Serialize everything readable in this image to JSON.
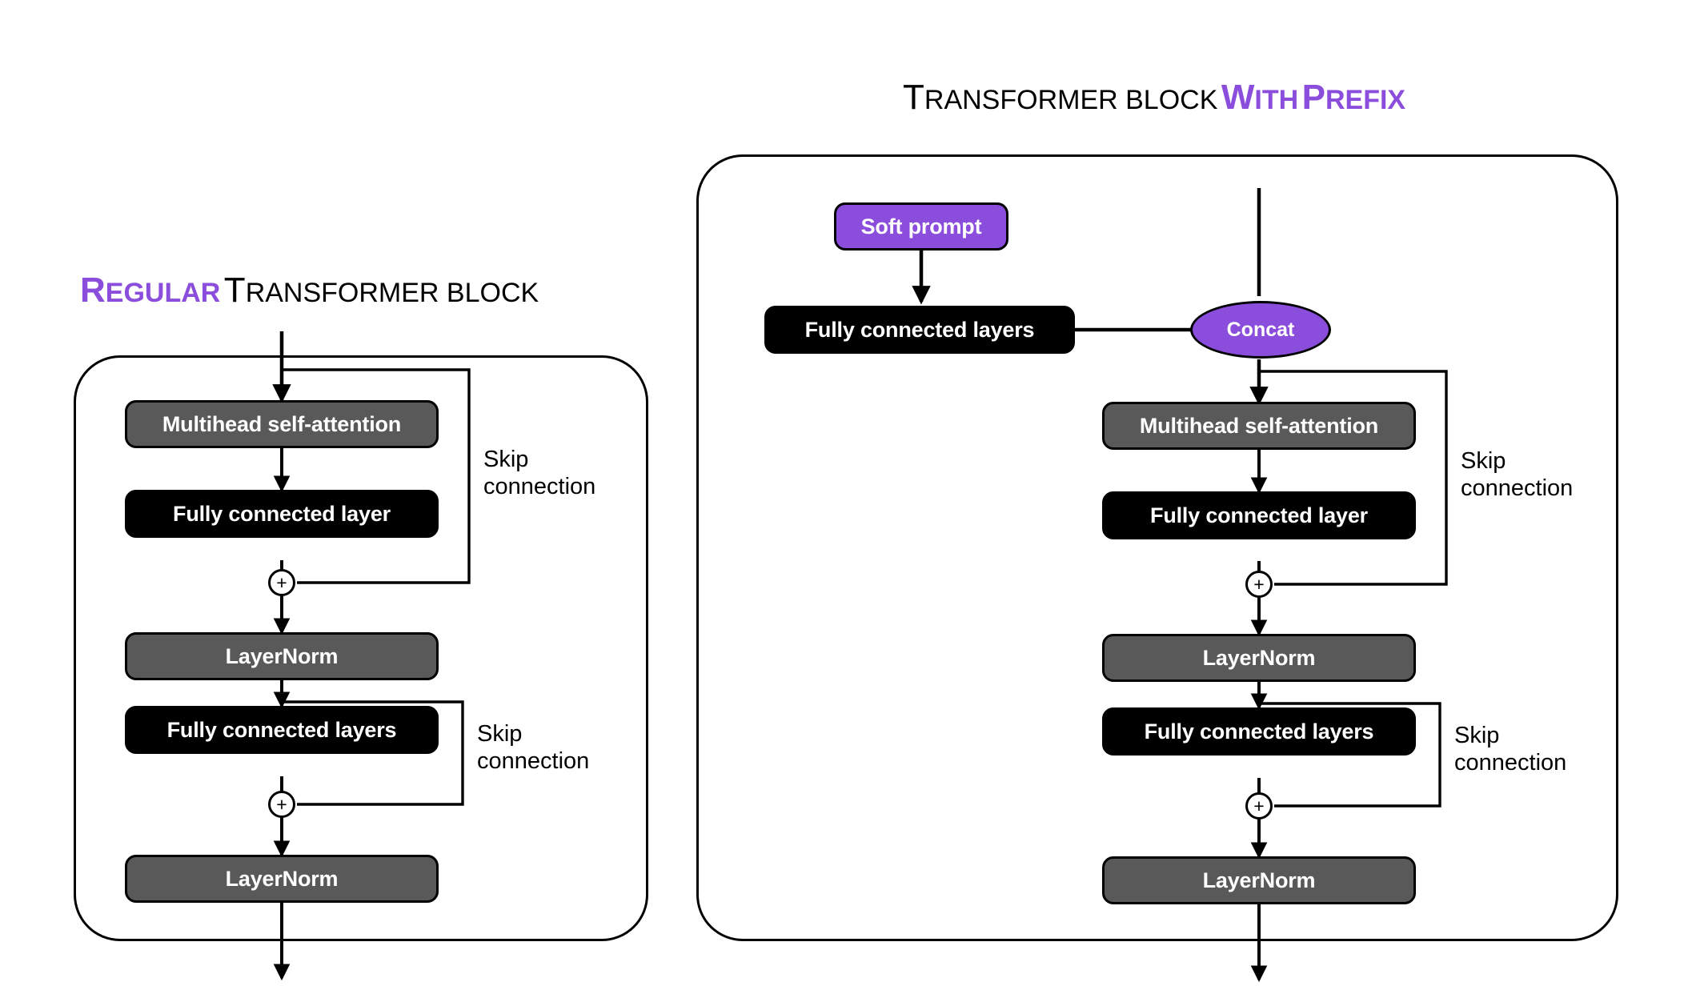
{
  "colors": {
    "purple": "#8B4DDB",
    "black": "#000000",
    "gray": "#595959",
    "white": "#FFFFFF",
    "background": "#FFFFFF"
  },
  "left_panel": {
    "title": {
      "part1_lead": "R",
      "part1_rest": "EGULAR",
      "part2_lead": "T",
      "part2_rest": "RANSFORMER BLOCK",
      "part1_color": "#8B4DDB",
      "part2_color": "#000000",
      "full_text": "Regular Transformer block"
    },
    "nodes": [
      {
        "id": "mhsa",
        "label": "Multihead self-attention",
        "style": "gray"
      },
      {
        "id": "fc1",
        "label": "Fully connected layer",
        "style": "black"
      },
      {
        "id": "add1",
        "label": "+",
        "style": "plus"
      },
      {
        "id": "ln1",
        "label": "LayerNorm",
        "style": "gray"
      },
      {
        "id": "fc2",
        "label": "Fully connected layers",
        "style": "black"
      },
      {
        "id": "add2",
        "label": "+",
        "style": "plus"
      },
      {
        "id": "ln2",
        "label": "LayerNorm",
        "style": "gray"
      }
    ],
    "skip_labels": [
      {
        "line1": "Skip",
        "line2": "connection"
      },
      {
        "line1": "Skip",
        "line2": "connection"
      }
    ]
  },
  "right_panel": {
    "title": {
      "part1_lead": "T",
      "part1_rest": "RANSFORMER BLOCK",
      "part2_lead": "W",
      "part2_rest": "ITH",
      "part3_lead": "P",
      "part3_rest": "REFIX",
      "part1_color": "#000000",
      "part2_color": "#8B4DDB",
      "part3_color": "#8B4DDB",
      "full_text": "Transformer block with Prefix"
    },
    "nodes": [
      {
        "id": "soft_prompt",
        "label": "Soft prompt",
        "style": "purple"
      },
      {
        "id": "fc_prefix",
        "label": "Fully connected layers",
        "style": "black"
      },
      {
        "id": "concat",
        "label": "Concat",
        "style": "ellipse-purple"
      },
      {
        "id": "mhsa",
        "label": "Multihead self-attention",
        "style": "gray"
      },
      {
        "id": "fc1",
        "label": "Fully connected layer",
        "style": "black"
      },
      {
        "id": "add1",
        "label": "+",
        "style": "plus"
      },
      {
        "id": "ln1",
        "label": "LayerNorm",
        "style": "gray"
      },
      {
        "id": "fc2",
        "label": "Fully connected layers",
        "style": "black"
      },
      {
        "id": "add2",
        "label": "+",
        "style": "plus"
      },
      {
        "id": "ln2",
        "label": "LayerNorm",
        "style": "gray"
      }
    ],
    "skip_labels": [
      {
        "line1": "Skip",
        "line2": "connection"
      },
      {
        "line1": "Skip",
        "line2": "connection"
      }
    ]
  }
}
